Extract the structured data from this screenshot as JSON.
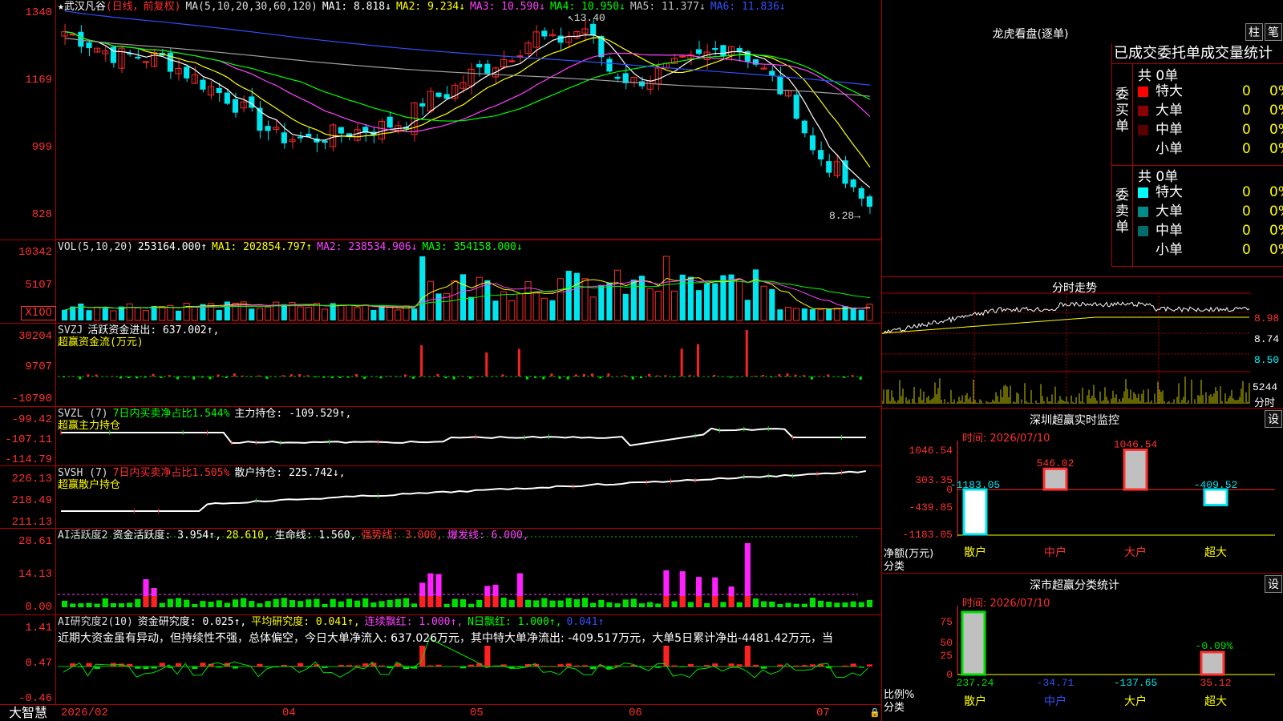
{
  "colors": {
    "up": "#ff2a2a",
    "down": "#00e5ee",
    "ma1": "#ffffff",
    "ma2": "#ffff00",
    "ma3": "#ff40ff",
    "ma4": "#00ff00",
    "ma5": "#a0a0a0",
    "ma6": "#3050ff",
    "grid": "#b00000"
  },
  "price_panel": {
    "stock_name": "★武汉凡谷",
    "period": "(日线，前复权)",
    "ma_params": "MA(5,10,20,30,60,120)",
    "ma1": "MA1: 8.818↓",
    "ma2": "MA2: 9.234↓",
    "ma3": "MA3: 10.590↓",
    "ma4": "MA4: 10.950↓",
    "ma5": "MA5: 11.377↓",
    "ma6": "MA6: 11.836↓",
    "high_label": "13.40",
    "low_label": "8.28→",
    "y_ticks": [
      "1340",
      "1169",
      "999",
      "828"
    ]
  },
  "vol_panel": {
    "params": "VOL(5,10,20)",
    "value": "253164.000↑",
    "ma1": "MA1: 202854.797↑",
    "ma2": "MA2: 238534.906↓",
    "ma3": "MA3: 354158.000↓",
    "y_ticks": [
      "10342",
      "5107"
    ],
    "unit_btn": "X100"
  },
  "svzj_panel": {
    "name": "SVZJ",
    "label": "活跃资金进出: 637.002↑,",
    "subtitle": "超赢资金流(万元)",
    "y_ticks": [
      "30204",
      "9707",
      "-10790"
    ]
  },
  "svzl_panel": {
    "name": "SVZL (7)",
    "ratio": "7日内买卖净占比1.544%",
    "hold": "主力持仓: -109.529↑,",
    "subtitle": "超赢主力持仓",
    "y_ticks": [
      "-99.42",
      "-107.11",
      "-114.79"
    ]
  },
  "svsh_panel": {
    "name": "SVSH (7)",
    "ratio": "7日内买卖净占比1.505%",
    "hold": "散户持仓: 225.742↓,",
    "subtitle": "超赢散户持仓",
    "y_ticks": [
      "226.13",
      "218.49",
      "211.13"
    ]
  },
  "ai_act_panel": {
    "name": "AI活跃度2",
    "act": "资金活跃度: 3.954↑,",
    "v2": "28.610,",
    "life": "生命线: 1.560,",
    "strong": "强势线: 3.000,",
    "burst": "爆发线: 6.000,",
    "y_ticks": [
      "28.61",
      "14.13",
      "0.00"
    ]
  },
  "ai_res_panel": {
    "name": "AI研究度2(10)",
    "res": "资金研究度: 0.025↑,",
    "avg": "平均研究度: 0.041↑,",
    "cont": "连续飘红: 1.000↑,",
    "nday": "N日飘红: 1.000↑,",
    "last": "0.041↑",
    "comment": "近期大资金虽有异动，但持续性不强，总体偏空，今日大单净流入: 637.026万元，其中特大单净流出: -409.517万元，大单5日累计净出-4481.42万元，当",
    "y_ticks": [
      "1.41",
      "0.47",
      "-0.46"
    ]
  },
  "xaxis": {
    "brand": "大智慧",
    "dates": [
      "2026/02",
      "04",
      "05",
      "06",
      "07"
    ]
  },
  "lhb": {
    "title": "龙虎看盘(逐单)",
    "btn1": "柱",
    "btn2": "笔",
    "header": "已成交委托单成交量统计",
    "buy": {
      "side": "委买单",
      "total": "共 0单",
      "rows": [
        {
          "name": "特大",
          "v": "0",
          "p": "0%",
          "c": "#ff0000"
        },
        {
          "name": "大单",
          "v": "0",
          "p": "0%",
          "c": "#8b0000"
        },
        {
          "name": "中单",
          "v": "0",
          "p": "0%",
          "c": "#5a0000"
        },
        {
          "name": "小单",
          "v": "0",
          "p": "0%",
          "c": ""
        }
      ]
    },
    "sell": {
      "side": "委卖单",
      "total": "共 0单",
      "rows": [
        {
          "name": "特大",
          "v": "0",
          "p": "0%",
          "c": "#00ffff"
        },
        {
          "name": "大单",
          "v": "0",
          "p": "0%",
          "c": "#008b8b"
        },
        {
          "name": "中单",
          "v": "0",
          "p": "0%",
          "c": "#006d6d"
        },
        {
          "name": "小单",
          "v": "0",
          "p": "0%",
          "c": ""
        }
      ]
    }
  },
  "intraday": {
    "title": "分时走势",
    "y_ticks": [
      "8.98",
      "8.74",
      "8.50"
    ],
    "vol_tick": "5244",
    "vol_label": "分时"
  },
  "sz_monitor": {
    "title": "深圳超赢实时监控",
    "btn": "设",
    "time": "时间: 2026/07/10",
    "y_ticks": [
      "1046.54",
      "303.35",
      "0",
      "-439.85",
      "-1183.05"
    ],
    "ylabel": "净额(万元)",
    "xlabel": "分类",
    "bars": [
      {
        "cat": "散户",
        "value": -1183.05,
        "label": "-1183.05"
      },
      {
        "cat": "中户",
        "value": 546.02,
        "label": "546.02"
      },
      {
        "cat": "大户",
        "value": 1046.54,
        "label": "1046.54"
      },
      {
        "cat": "超大",
        "value": -409.52,
        "label": "-409.52"
      }
    ]
  },
  "sz_stats": {
    "title": "深市超赢分类统计",
    "btn": "设",
    "time": "时间: 2026/07/10",
    "y_ticks": [
      "75",
      "50",
      "25",
      "0"
    ],
    "ylabel": "比例%",
    "xlabel": "分类",
    "bars": [
      {
        "cat": "散户",
        "value": 237.24,
        "label": "237.24"
      },
      {
        "cat": "中户",
        "value": -34.71,
        "label": "-34.71"
      },
      {
        "cat": "大户",
        "value": -137.65,
        "label": "-137.65"
      },
      {
        "cat": "超大",
        "value": 35.12,
        "label": "35.12"
      }
    ],
    "pct_label": "-0.09%"
  }
}
